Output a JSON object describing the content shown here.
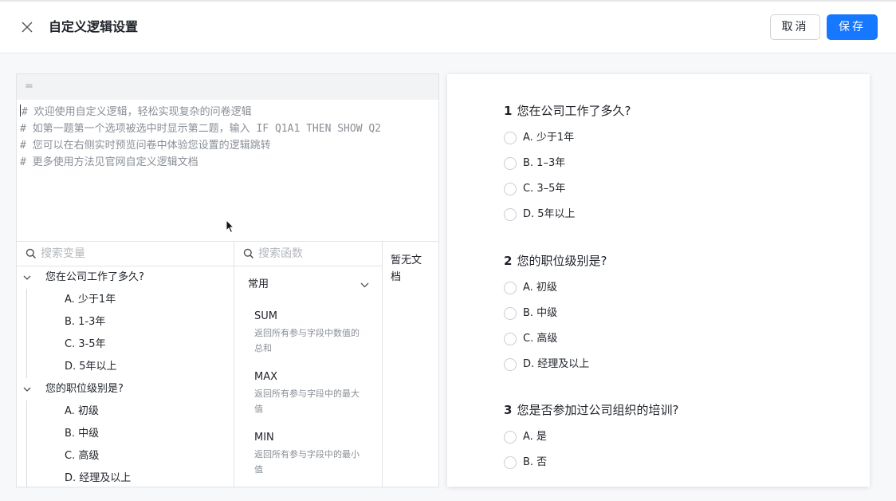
{
  "header": {
    "title": "自定义逻辑设置",
    "cancel_label": "取消",
    "save_label": "保存"
  },
  "editor": {
    "formula": "=",
    "lines": [
      "# 欢迎使用自定义逻辑，轻松实现复杂的问卷逻辑",
      "# 如第一题第一个选项被选中时显示第二题，输入 IF Q1A1 THEN SHOW Q2",
      "# 您可以在右侧实时预览问卷中体验您设置的逻辑跳转",
      "# 更多使用方法见官网自定义逻辑文档"
    ]
  },
  "variables": {
    "placeholder": "搜索变量",
    "groups": [
      {
        "label": "您在公司工作了多久?",
        "options": [
          "A. 少于1年",
          "B. 1-3年",
          "C. 3-5年",
          "D. 5年以上"
        ]
      },
      {
        "label": "您的职位级别是?",
        "options": [
          "A. 初级",
          "B. 中级",
          "C. 高级",
          "D. 经理及以上"
        ]
      }
    ]
  },
  "functions": {
    "placeholder": "搜索函数",
    "category": "常用",
    "items": [
      {
        "name": "SUM",
        "desc": "返回所有参与字段中数值的总和"
      },
      {
        "name": "MAX",
        "desc": "返回所有参与字段中的最大值"
      },
      {
        "name": "MIN",
        "desc": "返回所有参与字段中的最小值"
      }
    ]
  },
  "docs": {
    "empty_text": "暂无文档"
  },
  "preview": {
    "questions": [
      {
        "num": "1",
        "title": "您在公司工作了多久?",
        "options": [
          "A. 少于1年",
          "B. 1–3年",
          "C. 3–5年",
          "D. 5年以上"
        ]
      },
      {
        "num": "2",
        "title": "您的职位级别是?",
        "options": [
          "A. 初级",
          "B. 中级",
          "C. 高级",
          "D. 经理及以上"
        ]
      },
      {
        "num": "3",
        "title": "您是否参加过公司组织的培训?",
        "options": [
          "A. 是",
          "B. 否"
        ]
      }
    ]
  },
  "colors": {
    "primary": "#1677ff"
  }
}
